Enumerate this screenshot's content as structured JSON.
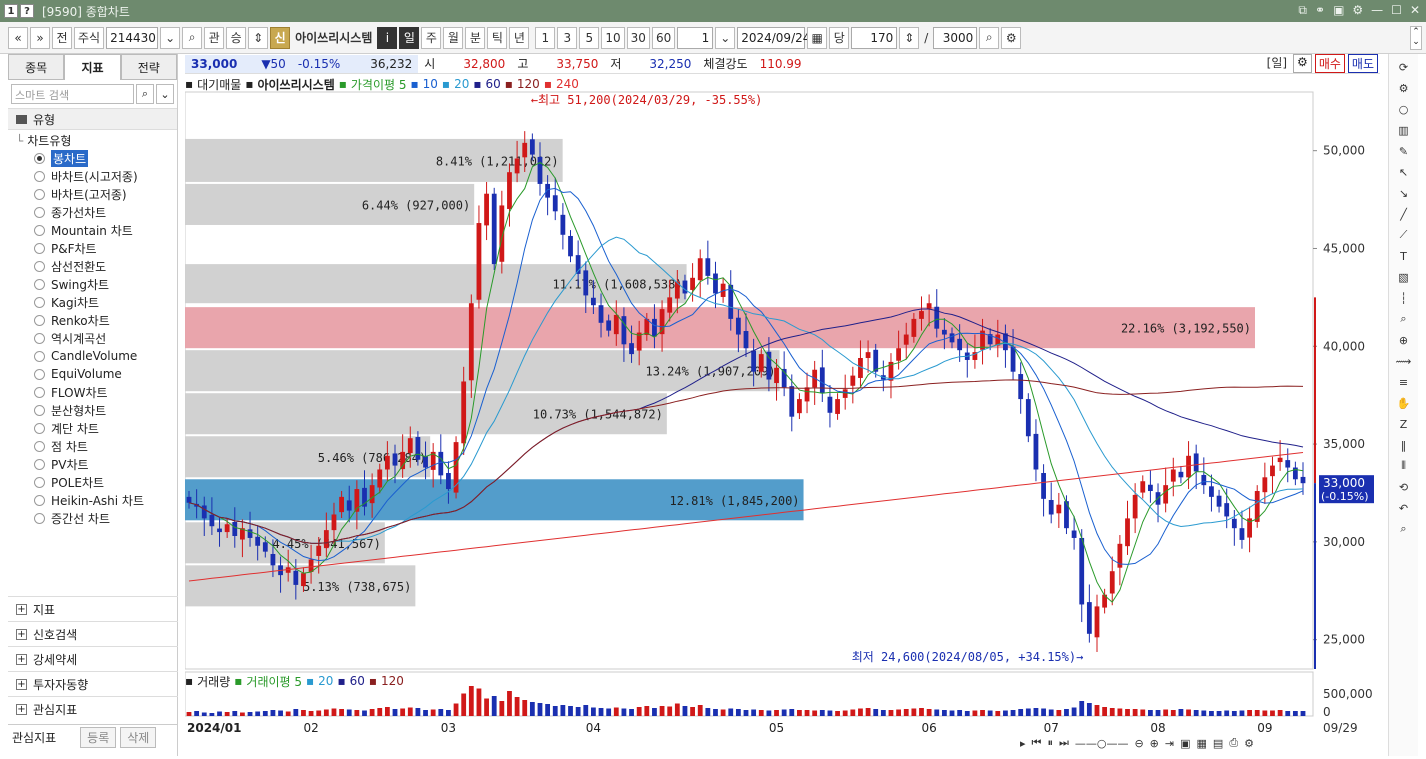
{
  "window": {
    "title": "[9590] 종합차트",
    "num_badge_1": "1",
    "num_badge_2": "?"
  },
  "toolbar": {
    "prev_label": "«",
    "down_label": "»",
    "jeon": "전",
    "jusik": "주식",
    "code": "214430",
    "gwan": "관",
    "seung": "승",
    "shin": "신",
    "stock_name": "아이쓰리시스템",
    "info": "i",
    "periods": [
      "일",
      "주",
      "월",
      "분",
      "틱",
      "년"
    ],
    "intervals": [
      "1",
      "3",
      "5",
      "10",
      "30",
      "60"
    ],
    "interval_value": "1",
    "date": "2024/09/24",
    "dang": "당",
    "count": "170",
    "slash": "/",
    "max": "3000"
  },
  "left_panel": {
    "tabs": [
      "종목",
      "지표",
      "전략"
    ],
    "search_placeholder": "스마트 검색",
    "section_type": "유형",
    "tree_parent": "차트유형",
    "chart_types": [
      "봉차트",
      "바차트(시고저종)",
      "바차트(고저종)",
      "종가선차트",
      "Mountain 차트",
      "P&F차트",
      "삼선전환도",
      "Swing차트",
      "Kagi차트",
      "Renko차트",
      "역시계곡선",
      "CandleVolume",
      "EquiVolume",
      "FLOW차트",
      "분산형차트",
      "계단 차트",
      "점 차트",
      "PV차트",
      "POLE차트",
      "Heikin-Ashi 차트",
      "증간선 차트"
    ],
    "bottom_sections": [
      "지표",
      "신호검색",
      "강세약세",
      "투자자동향",
      "관심지표"
    ],
    "fav_label": "관심지표",
    "fav_add": "등록",
    "fav_del": "삭제"
  },
  "price_bar": {
    "price": "33,000",
    "change": "▼50",
    "change_pct": "-0.15%",
    "volume": "36,232",
    "open_label": "시",
    "open": "32,800",
    "high_label": "고",
    "high": "33,750",
    "low_label": "저",
    "low": "32,250",
    "strength_label": "체결강도",
    "strength": "110.99",
    "period_tag": "[일]",
    "buy": "매수",
    "sell": "매도"
  },
  "legend": {
    "main": "대기매물",
    "name": "아이쓰리시스템",
    "ma_label": "가격이평 5",
    "ma10": "10",
    "ma20": "20",
    "ma60": "60",
    "ma120": "120",
    "ma240": "240",
    "vol_main": "거래량",
    "vol_ma": "거래이평 5",
    "vol20": "20",
    "vol60": "60",
    "vol120": "120"
  },
  "colors": {
    "up": "#d01818",
    "down": "#1a2fb0",
    "ma5": "#2a9a2a",
    "ma10": "#1a60d0",
    "ma20": "#2a9ad0",
    "ma60": "#20208a",
    "ma120": "#8a2020",
    "ma240": "#e03030"
  },
  "chart_data": {
    "type": "candlestick",
    "y_ticks": [
      "50,000",
      "45,000",
      "40,000",
      "35,000",
      "30,000",
      "25,000"
    ],
    "ylim": [
      23500,
      53000
    ],
    "x_labels": [
      "2024/01",
      "02",
      "03",
      "04",
      "05",
      "06",
      "07",
      "08",
      "09"
    ],
    "x_end_label": "09/29",
    "current_price_label": "33,000",
    "current_pct_label": "(-0.15%)",
    "high_annotation": "←최고 51,200(2024/03/29, -35.55%)",
    "low_annotation": "최저 24,600(2024/08/05, +34.15%)→",
    "volume_ticks": [
      "500,000",
      "0"
    ],
    "volume_profile": [
      {
        "label": "8.41% (1,211,012)",
        "low": 48300,
        "high": 50600,
        "highlight": "none"
      },
      {
        "label": "6.44% (927,000)",
        "low": 46100,
        "high": 48300,
        "highlight": "none"
      },
      {
        "label": "11.17% (1,608,538)",
        "low": 42100,
        "high": 44200,
        "highlight": "none"
      },
      {
        "label": "22.16% (3,192,550)",
        "low": 39800,
        "high": 42000,
        "highlight": "red"
      },
      {
        "label": "13.24% (1,907,209)",
        "low": 37600,
        "high": 39800,
        "highlight": "none"
      },
      {
        "label": "10.73% (1,544,872)",
        "low": 35400,
        "high": 37600,
        "highlight": "none"
      },
      {
        "label": "5.46% (786,284)",
        "low": 33200,
        "high": 35400,
        "highlight": "none"
      },
      {
        "label": "12.81% (1,845,200)",
        "low": 31000,
        "high": 33200,
        "highlight": "blue"
      },
      {
        "label": "4.45% (641,567)",
        "low": 28800,
        "high": 31000,
        "highlight": "none"
      },
      {
        "label": "5.13% (738,675)",
        "low": 26600,
        "high": 28800,
        "highlight": "none"
      }
    ],
    "closes": [
      32000,
      31800,
      31200,
      30800,
      30500,
      30900,
      30300,
      30700,
      30200,
      29800,
      29500,
      28800,
      28300,
      28700,
      27800,
      28400,
      29100,
      29800,
      30600,
      31400,
      32300,
      31600,
      32700,
      31800,
      32900,
      33700,
      34400,
      33900,
      34600,
      35300,
      34200,
      33800,
      34600,
      33400,
      32700,
      35100,
      38200,
      42200,
      46300,
      47800,
      44200,
      47200,
      48900,
      49600,
      50400,
      49800,
      48300,
      47600,
      46900,
      45700,
      44600,
      43700,
      42600,
      42100,
      41200,
      40800,
      41600,
      40100,
      39600,
      40700,
      41400,
      40500,
      41900,
      42500,
      43300,
      42700,
      43500,
      44500,
      43600,
      42700,
      43200,
      41400,
      40600,
      39900,
      38700,
      39600,
      38300,
      38900,
      37900,
      36400,
      37300,
      37900,
      38800,
      37600,
      36600,
      37300,
      37800,
      38500,
      39400,
      39700,
      38700,
      38300,
      39200,
      39900,
      40600,
      41400,
      41800,
      42200,
      40900,
      40600,
      40200,
      39800,
      39300,
      39700,
      40800,
      40100,
      40600,
      39800,
      38700,
      37300,
      35400,
      33700,
      32200,
      31400,
      31900,
      30700,
      30200,
      26800,
      25300,
      26700,
      27300,
      28500,
      29900,
      31200,
      32400,
      33100,
      32600,
      31900,
      32900,
      33700,
      33300,
      34400,
      33600,
      32900,
      32300,
      31800,
      31300,
      30700,
      30100,
      31200,
      32600,
      33300,
      33900,
      34300,
      33800,
      33200,
      33000
    ],
    "volumes": [
      0.08,
      0.1,
      0.07,
      0.06,
      0.09,
      0.08,
      0.1,
      0.07,
      0.08,
      0.09,
      0.1,
      0.12,
      0.11,
      0.09,
      0.14,
      0.12,
      0.1,
      0.11,
      0.13,
      0.15,
      0.14,
      0.13,
      0.12,
      0.11,
      0.14,
      0.16,
      0.18,
      0.14,
      0.15,
      0.17,
      0.16,
      0.12,
      0.13,
      0.14,
      0.12,
      0.25,
      0.45,
      0.6,
      0.55,
      0.35,
      0.4,
      0.3,
      0.5,
      0.38,
      0.32,
      0.28,
      0.26,
      0.24,
      0.2,
      0.22,
      0.2,
      0.18,
      0.22,
      0.17,
      0.16,
      0.15,
      0.17,
      0.15,
      0.14,
      0.18,
      0.2,
      0.16,
      0.2,
      0.19,
      0.25,
      0.2,
      0.18,
      0.22,
      0.16,
      0.14,
      0.13,
      0.15,
      0.14,
      0.12,
      0.13,
      0.12,
      0.11,
      0.12,
      0.13,
      0.14,
      0.12,
      0.12,
      0.11,
      0.12,
      0.11,
      0.1,
      0.11,
      0.13,
      0.15,
      0.16,
      0.14,
      0.12,
      0.12,
      0.13,
      0.14,
      0.15,
      0.16,
      0.14,
      0.13,
      0.12,
      0.11,
      0.12,
      0.1,
      0.11,
      0.12,
      0.11,
      0.1,
      0.11,
      0.12,
      0.14,
      0.15,
      0.16,
      0.15,
      0.13,
      0.12,
      0.14,
      0.17,
      0.3,
      0.26,
      0.22,
      0.18,
      0.16,
      0.15,
      0.14,
      0.14,
      0.13,
      0.12,
      0.12,
      0.13,
      0.12,
      0.14,
      0.13,
      0.12,
      0.11,
      0.1,
      0.1,
      0.11,
      0.1,
      0.11,
      0.12,
      0.12,
      0.11,
      0.11,
      0.12,
      0.1,
      0.1,
      0.1
    ]
  }
}
